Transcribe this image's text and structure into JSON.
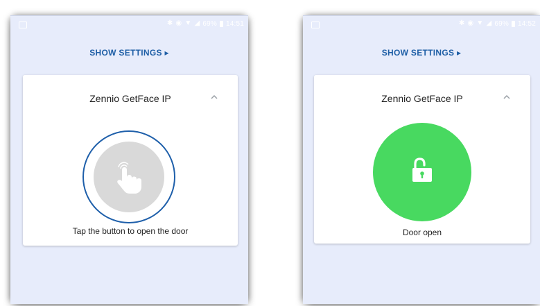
{
  "screens": [
    {
      "status": {
        "battery_text": "69%",
        "time": "14:51"
      },
      "show_settings_label": "SHOW SETTINGS ▸",
      "card": {
        "title": "Zennio GetFace IP",
        "caption": "Tap the button to open the door",
        "icon": "hand-tap-icon"
      }
    },
    {
      "status": {
        "battery_text": "69%",
        "time": "14:52"
      },
      "show_settings_label": "SHOW SETTINGS ▸",
      "card": {
        "title": "Zennio GetFace IP",
        "caption": "Door open",
        "icon": "unlocked-padlock-icon"
      }
    }
  ],
  "colors": {
    "background": "#e7ecfb",
    "accent_blue": "#1f5fa6",
    "button_ring": "#1e5faa",
    "button_idle": "#d9d9d9",
    "door_open_green": "#48d960"
  }
}
